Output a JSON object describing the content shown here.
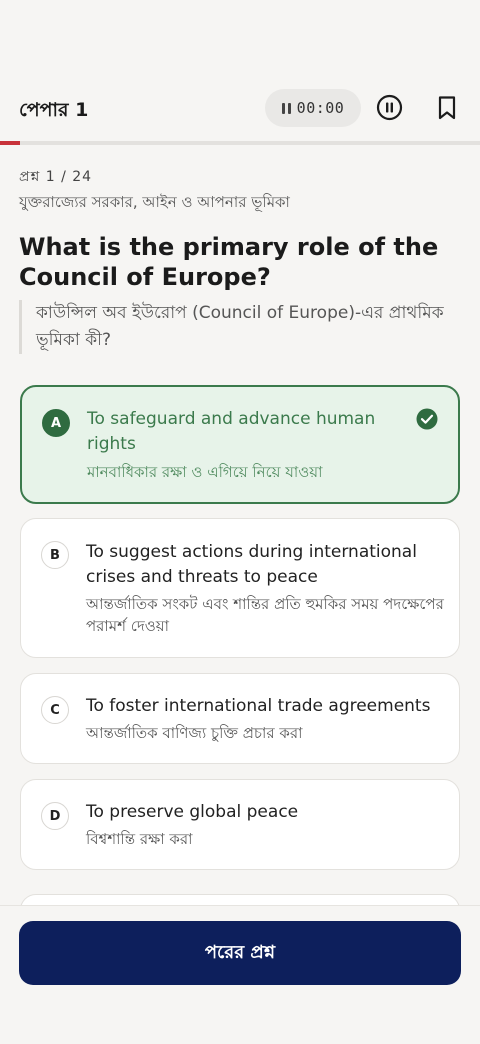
{
  "header": {
    "title": "পেপার 1",
    "timer": "00:00",
    "icons": {
      "timer": "pause-glyph",
      "pause": "pause-circle-icon",
      "bookmark": "bookmark-icon"
    }
  },
  "progress": {
    "current": 1,
    "total": 24,
    "fraction": 0.0417,
    "color": "#c8323a"
  },
  "question": {
    "counter": "প্রশ্ন 1 / 24",
    "category": "যুক্তরাজ্যের সরকার, আইন ও আপনার ভূমিকা",
    "text": "What is the primary role of the Council of Europe?",
    "translation": "কাউন্সিল অব ইউরোপ (Council of Europe)-এর প্রাথমিক ভূমিকা কী?"
  },
  "options": [
    {
      "letter": "A",
      "text": "To safeguard and advance human rights",
      "translation": "মানবাধিকার রক্ষা ও এগিয়ে নিয়ে যাওয়া",
      "selected": true
    },
    {
      "letter": "B",
      "text": "To suggest actions during international crises and threats to peace",
      "translation": "আন্তর্জাতিক সংকট এবং শান্তির প্রতি হুমকির সময় পদক্ষেপের পরামর্শ দেওয়া",
      "selected": false
    },
    {
      "letter": "C",
      "text": "To foster international trade agreements",
      "translation": "আন্তর্জাতিক বাণিজ্য চুক্তি প্রচার করা",
      "selected": false
    },
    {
      "letter": "D",
      "text": "To preserve global peace",
      "translation": "বিশ্বশান্তি রক্ষা করা",
      "selected": false
    }
  ],
  "footer": {
    "next_label": "পরের প্রশ্ন"
  },
  "colors": {
    "accent": "#0d1f5c",
    "selected_border": "#3b7a4c",
    "selected_bg": "#e7f3e9",
    "progress": "#c8323a"
  }
}
